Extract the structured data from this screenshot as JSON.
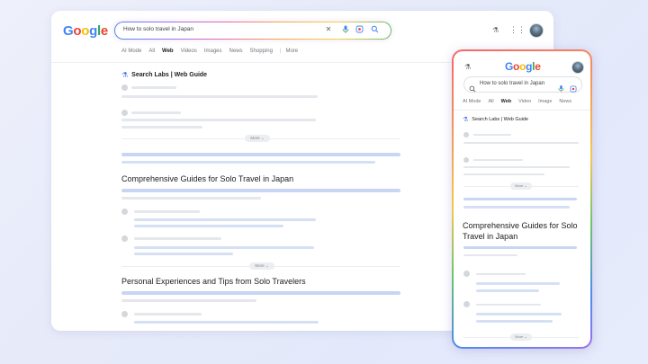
{
  "desktop": {
    "logo_letters": [
      {
        "ch": "G",
        "color": "#4285F4"
      },
      {
        "ch": "o",
        "color": "#EA4335"
      },
      {
        "ch": "o",
        "color": "#FBBC05"
      },
      {
        "ch": "g",
        "color": "#4285F4"
      },
      {
        "ch": "l",
        "color": "#34A853"
      },
      {
        "ch": "e",
        "color": "#EA4335"
      }
    ],
    "search_query": "How to solo travel in Japan",
    "tabs": [
      "AI Mode",
      "All",
      "Web",
      "Videos",
      "Images",
      "News",
      "Shopping",
      "|",
      "More"
    ],
    "active_tab": "Web",
    "labs_label": "Search Labs | Web Guide",
    "more_label": "More ⌄",
    "heading_1": "Comprehensive Guides for Solo Travel in Japan",
    "heading_2": "Personal Experiences and Tips from Solo Travelers",
    "icons": {
      "clear": "close-icon",
      "mic": "mic-icon",
      "lens": "lens-icon",
      "search": "search-icon",
      "labs": "flask-icon",
      "apps": "apps-grid-icon"
    }
  },
  "mobile": {
    "search_query": "How to solo travel in Japan",
    "tabs": [
      "AI Mode",
      "All",
      "Web",
      "Video",
      "Image",
      "News"
    ],
    "active_tab": "Web",
    "labs_label": "Search Labs | Web Guide",
    "more_label": "More ⌄",
    "heading_1": "Comprehensive Guides for Solo Travel in Japan"
  },
  "colors": {
    "accent_blue": "#4285F4",
    "placeholder_bar": "#e4e7eb",
    "link_bar": "#c8d6f3"
  }
}
